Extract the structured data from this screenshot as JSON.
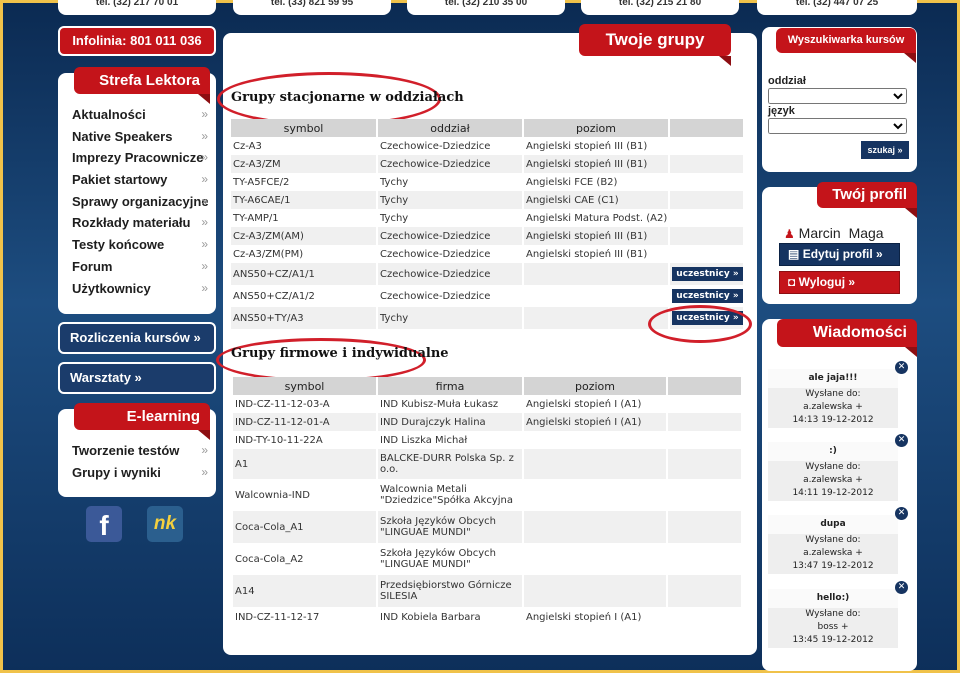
{
  "top_boxes": [
    "tel. (32) 217 70 01",
    "tel. (33) 821 59 95",
    "tel. (32) 210 35 00",
    "tel. (32) 215 21 80",
    "tel. (32) 447 07 25"
  ],
  "infolinia": "Infolinia: 801 011 036",
  "strefa": {
    "title": "Strefa Lektora",
    "items": [
      "Aktualności",
      "Native Speakers",
      "Imprezy Pracownicze",
      "Pakiet startowy",
      "Sprawy organizacyjne",
      "Rozkłady materiału",
      "Testy końcowe",
      "Forum",
      "Użytkownicy"
    ]
  },
  "rozliczenia": "Rozliczenia kursów »",
  "warsztaty": "Warsztaty »",
  "elearning": {
    "title": "E-learning",
    "items": [
      "Tworzenie testów",
      "Grupy i wyniki"
    ]
  },
  "social": {
    "fb": "f",
    "nk": "nk"
  },
  "main": {
    "title": "Twoje grupy",
    "stationary": {
      "title": "Grupy stacjonarne w oddziałach",
      "headers": [
        "symbol",
        "oddział",
        "poziom",
        ""
      ],
      "rows": [
        [
          "Cz-A3",
          "Czechowice-Dziedzice",
          "Angielski stopień III (B1)",
          ""
        ],
        [
          "Cz-A3/ZM",
          "Czechowice-Dziedzice",
          "Angielski stopień III (B1)",
          ""
        ],
        [
          "TY-A5FCE/2",
          "Tychy",
          "Angielski FCE (B2)",
          ""
        ],
        [
          "TY-A6CAE/1",
          "Tychy",
          "Angielski CAE (C1)",
          ""
        ],
        [
          "TY-AMP/1",
          "Tychy",
          "Angielski Matura Podst. (A2)",
          ""
        ],
        [
          "Cz-A3/ZM(AM)",
          "Czechowice-Dziedzice",
          "Angielski stopień III (B1)",
          ""
        ],
        [
          "Cz-A3/ZM(PM)",
          "Czechowice-Dziedzice",
          "Angielski stopień III (B1)",
          ""
        ],
        [
          "ANS50+CZ/A1/1",
          "Czechowice-Dziedzice",
          "",
          "uczestnicy »"
        ],
        [
          "ANS50+CZ/A1/2",
          "Czechowice-Dziedzice",
          "",
          "uczestnicy »"
        ],
        [
          "ANS50+TY/A3",
          "Tychy",
          "",
          "uczestnicy »"
        ]
      ]
    },
    "company": {
      "title": "Grupy firmowe i indywidualne",
      "headers": [
        "symbol",
        "firma",
        "poziom",
        ""
      ],
      "rows": [
        [
          "IND-CZ-11-12-03-A",
          "IND Kubisz-Muła Łukasz",
          "Angielski stopień I (A1)"
        ],
        [
          "IND-CZ-11-12-01-A",
          "IND Durajczyk Halina",
          "Angielski stopień I (A1)"
        ],
        [
          "IND-TY-10-11-22A",
          "IND Liszka Michał",
          ""
        ],
        [
          "A1",
          "BALCKE-DURR Polska Sp. z o.o.",
          ""
        ],
        [
          "Walcownia-IND",
          "Walcownia Metali \"Dziedzice\"Spółka Akcyjna",
          ""
        ],
        [
          "Coca-Cola_A1",
          "Szkoła Języków Obcych \"LINGUAE MUNDI\"",
          ""
        ],
        [
          "Coca-Cola_A2",
          "Szkoła Języków Obcych \"LINGUAE MUNDI\"",
          ""
        ],
        [
          "A14",
          "Przedsiębiorstwo Górnicze SILESIA",
          ""
        ],
        [
          "IND-CZ-11-12-17",
          "IND Kobiela Barbara",
          "Angielski stopień I (A1)"
        ]
      ]
    }
  },
  "search": {
    "title": "Wyszukiwarka kursów",
    "label1": "oddział",
    "label2": "język",
    "button": "szukaj »"
  },
  "profile": {
    "title": "Twój profil",
    "first": "Marcin",
    "last": "Maga",
    "edit": "Edytuj profil »",
    "logout": "Wyloguj »"
  },
  "messages": {
    "title": "Wiadomości",
    "items": [
      {
        "text": "ale jaja!!!",
        "sent": "Wysłane do:",
        "to": "a.zalewska +",
        "date": "14:13 19-12-2012"
      },
      {
        "text": ":)",
        "sent": "Wysłane do:",
        "to": "a.zalewska +",
        "date": "14:11 19-12-2012"
      },
      {
        "text": "dupa",
        "sent": "Wysłane do:",
        "to": "a.zalewska +",
        "date": "13:47 19-12-2012"
      },
      {
        "text": "hello:)",
        "sent": "Wysłane do:",
        "to": "boss +",
        "date": "13:45 19-12-2012"
      }
    ]
  }
}
